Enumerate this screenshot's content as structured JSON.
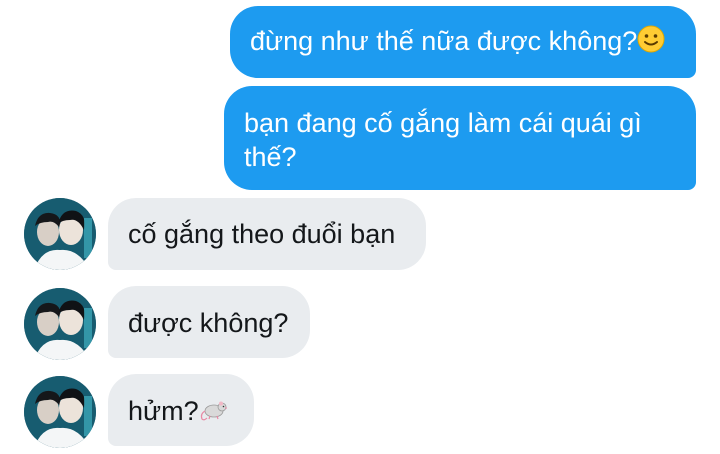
{
  "messages": [
    {
      "direction": "outgoing",
      "text": "đừng như thế nữa được không?",
      "emoji": "slightly-smiling-face"
    },
    {
      "direction": "outgoing",
      "text": "bạn đang cố gắng làm cái quái gì thế?"
    },
    {
      "direction": "incoming",
      "text": "cố gắng theo đuổi bạn",
      "avatar": "contact-avatar"
    },
    {
      "direction": "incoming",
      "text": "được không?",
      "avatar": "contact-avatar"
    },
    {
      "direction": "incoming",
      "text": "hửm?",
      "emoji": "rat"
    }
  ],
  "colors": {
    "outgoing_bubble": "#1d9bf0",
    "incoming_bubble": "#e9ecef",
    "outgoing_text": "#ffffff",
    "incoming_text": "#14171a"
  }
}
